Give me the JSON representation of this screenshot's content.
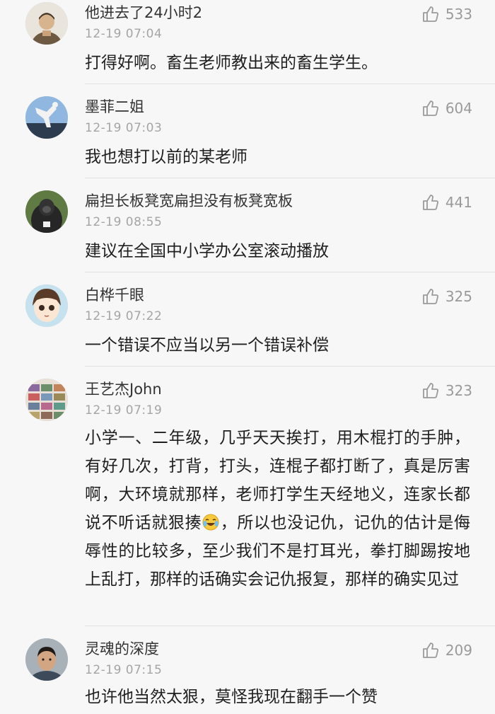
{
  "comments": [
    {
      "username": "他进去了24小时2",
      "time": "12-19 07:04",
      "likes": "533",
      "text": "打得好啊。畜生老师教出来的畜生学生。"
    },
    {
      "username": "墨菲二姐",
      "time": "12-19 07:03",
      "likes": "604",
      "text": "我也想打以前的某老师"
    },
    {
      "username": "扁担长板凳宽扁担没有板凳宽板",
      "time": "12-19 08:55",
      "likes": "441",
      "text": "建议在全国中小学办公室滚动播放"
    },
    {
      "username": "白桦千眼",
      "time": "12-19 07:22",
      "likes": "325",
      "text": "一个错误不应当以另一个错误补偿"
    },
    {
      "username": "王艺杰John",
      "time": "12-19 07:19",
      "likes": "323",
      "text_before_emoji": "小学一、二年级，几乎天天挨打，用木棍打的手肿，有好几次，打背，打头，连棍子都打断了，真是厉害啊，大环境就那样，老师打学生天经地义，连家长都说不听话就狠揍",
      "emoji": "laughing-crying-emoji",
      "text_after_emoji": "，所以也没记仇，记仇的估计是侮辱性的比较多，至少我们不是打耳光，拳打脚踢按地上乱打，那样的话确实会记仇报复，那样的确实见过"
    },
    {
      "username": "灵魂的深度",
      "time": "12-19 07:15",
      "likes": "209",
      "text": "也许他当然太狠，莫怪我现在翻手一个赞"
    }
  ],
  "icons": {
    "like": "thumbs-up-icon"
  },
  "colors": {
    "background": "#f7f7f7",
    "divider": "#e1e1e1",
    "meta": "#a5a5a5",
    "like": "#9a9a9a"
  }
}
